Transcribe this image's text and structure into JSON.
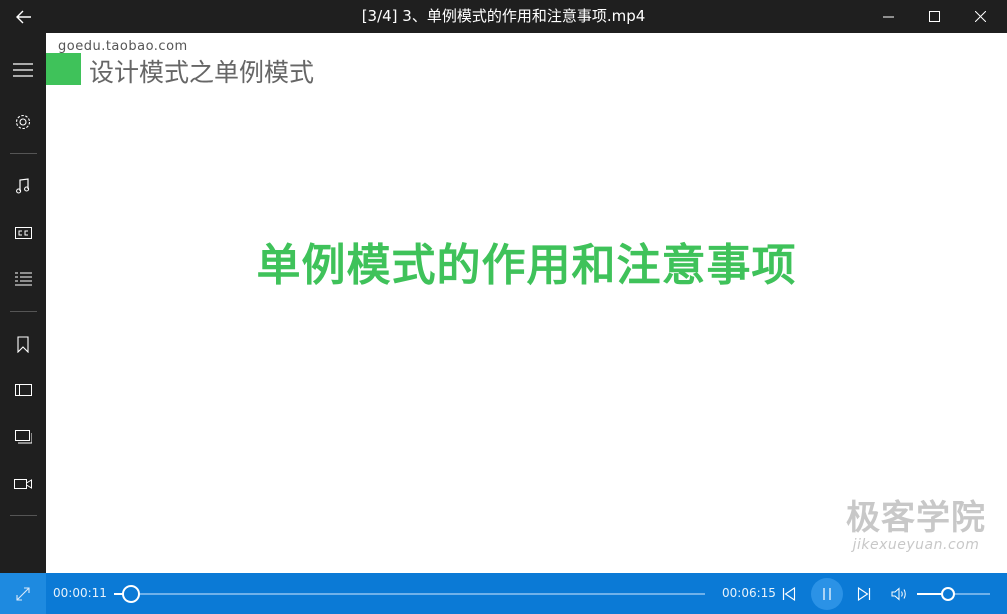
{
  "window": {
    "title": "[3/4] 3、单例模式的作用和注意事项.mp4"
  },
  "sidebar": {
    "items": [
      {
        "icon": "hamburger-menu-icon"
      },
      {
        "icon": "gear-icon"
      },
      {
        "icon": "music-note-icon"
      },
      {
        "icon": "closed-captions-icon"
      },
      {
        "icon": "playlist-icon"
      },
      {
        "icon": "bookmark-icon"
      },
      {
        "icon": "sidebar-panel-icon"
      },
      {
        "icon": "screen-icon"
      },
      {
        "icon": "video-camera-icon"
      }
    ]
  },
  "video": {
    "watermark_top": "goedu.taobao.com",
    "slide_heading": "设计模式之单例模式",
    "slide_title": "单例模式的作用和注意事项",
    "logo_cn": "极客学院",
    "logo_en": "jikexueyuan.com",
    "accent_color": "#3fc25a"
  },
  "player": {
    "elapsed": "00:00:11",
    "total": "00:06:15",
    "progress_fraction": 0.029,
    "volume_fraction": 0.43,
    "bar_color": "#0b7ad6"
  }
}
